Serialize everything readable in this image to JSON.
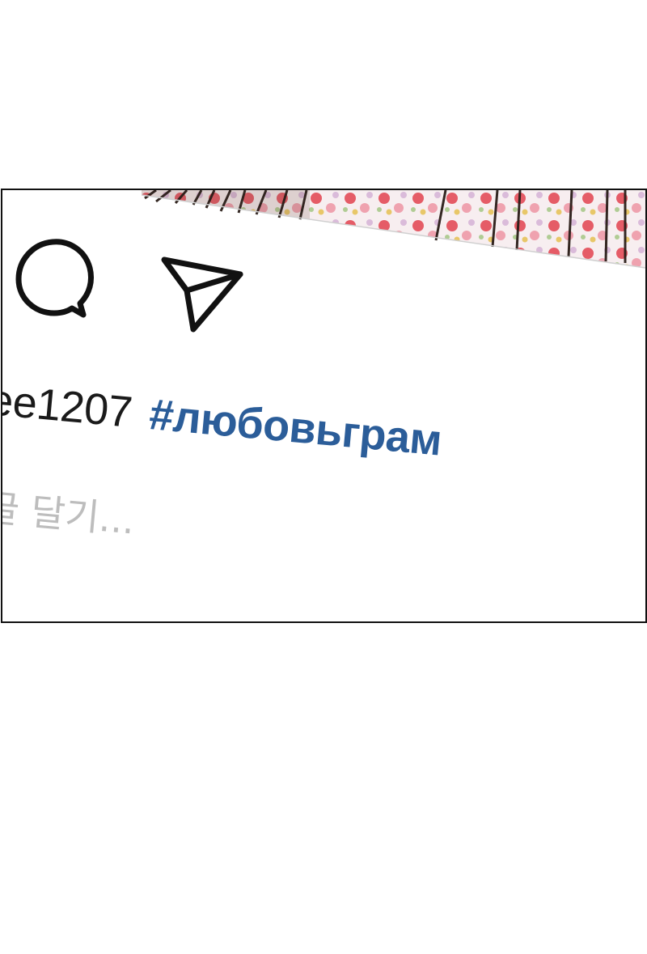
{
  "post": {
    "username": "ee1207",
    "hashtag": "#любовьграм",
    "comment_placeholder": "글 달기..."
  },
  "icons": {
    "comment": "speech-bubble-icon",
    "share": "paper-plane-icon"
  },
  "colors": {
    "hashtag": "#2b5d99",
    "placeholder": "#bdbdbd",
    "border": "#111111",
    "text": "#1a1a1a"
  }
}
